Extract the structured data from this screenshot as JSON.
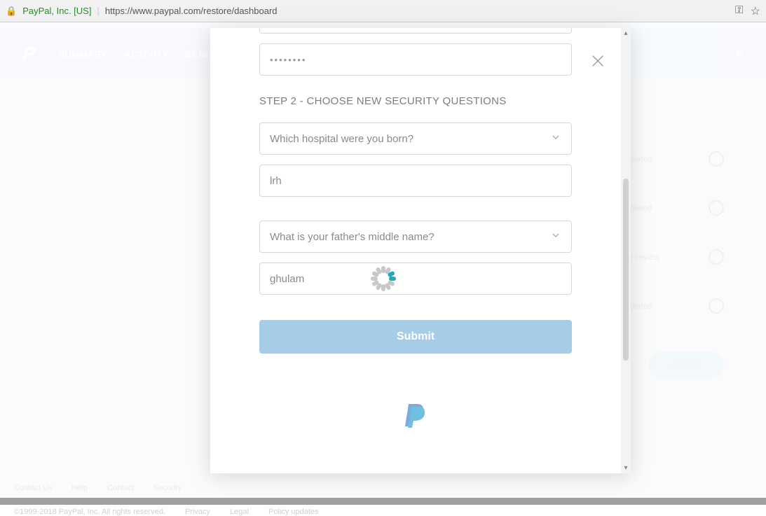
{
  "browser": {
    "ev_identity": "PayPal, Inc. [US]",
    "url": "https://www.paypal.com/restore/dashboard"
  },
  "nav": {
    "items": [
      "SUMMARY",
      "ACTIVITY",
      "SEND & REQUEST"
    ]
  },
  "background_status": {
    "items": [
      {
        "label": "Completed"
      },
      {
        "label": "Completed"
      },
      {
        "label": "ed for review"
      },
      {
        "label": "Completed"
      }
    ],
    "resolve_label": "esolve"
  },
  "footer": {
    "row1": [
      "Contact Us",
      "Help",
      "Contact",
      "Security"
    ],
    "row2_copyright": "©1999-2018 PayPal, Inc. All rights reserved.",
    "row2_links": [
      "Privacy",
      "Legal",
      "Policy updates"
    ]
  },
  "modal": {
    "password_answer": "••••••••",
    "step2_title": "STEP 2 - CHOOSE NEW SECURITY QUESTIONS",
    "q1_select": "Which hospital were you born?",
    "q1_answer": "lrh",
    "q2_select": "What is your father's middle name?",
    "q2_answer": "ghulam",
    "submit_label": "Submit"
  }
}
